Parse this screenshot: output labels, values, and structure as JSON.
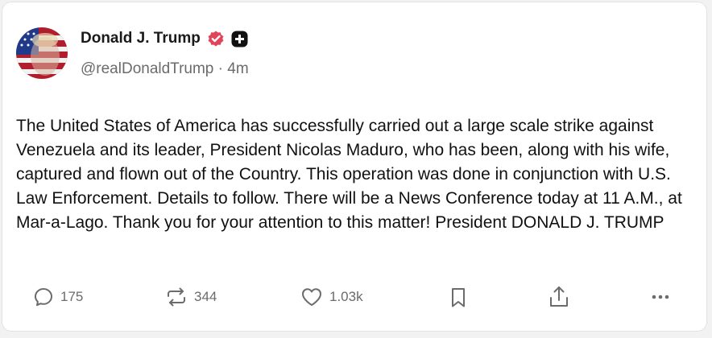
{
  "author": {
    "display_name": "Donald J. Trump",
    "handle": "@realDonaldTrump",
    "separator": "·",
    "time_ago": "4m",
    "verified_icon": "verified-badge-icon",
    "verified_color": "#e2445c",
    "plus_icon": "plus-badge-icon"
  },
  "post": {
    "text": "The United States of America has successfully carried out a large scale strike against Venezuela and its leader, President Nicolas Maduro, who has been, along with his wife, captured and flown out of the Country. This operation was done in conjunction with U.S. Law Enforcement. Details to follow. There will be a News Conference today at 11 A.M., at Mar-a-Lago. Thank you for your attention to this matter! President DONALD J. TRUMP"
  },
  "actions": {
    "reply": {
      "icon": "reply-icon",
      "count": "175"
    },
    "repost": {
      "icon": "repost-icon",
      "count": "344"
    },
    "like": {
      "icon": "heart-icon",
      "count": "1.03k"
    },
    "bookmark": {
      "icon": "bookmark-icon"
    },
    "share": {
      "icon": "share-icon"
    },
    "more": {
      "icon": "more-icon"
    }
  }
}
